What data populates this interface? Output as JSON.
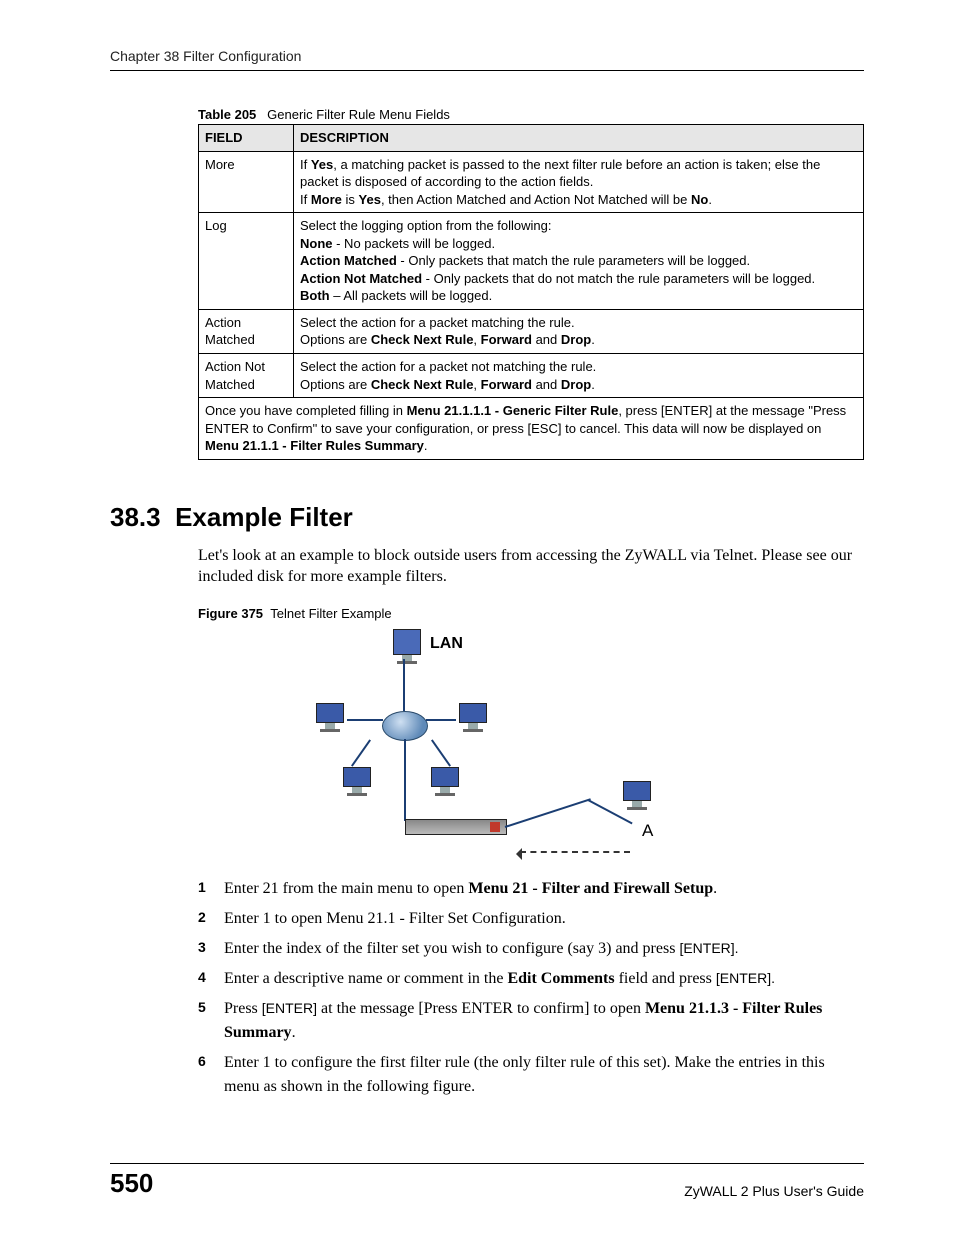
{
  "header": {
    "running_head": "Chapter 38 Filter Configuration"
  },
  "table": {
    "caption_number": "Table 205",
    "caption_title": "Generic Filter Rule Menu Fields",
    "headers": {
      "field": "FIELD",
      "description": "DESCRIPTION"
    },
    "rows": [
      {
        "field": "More",
        "lines": [
          {
            "pre": "If ",
            "b1": "Yes",
            "mid": ", a matching packet is passed to the next filter rule before an action is taken; else the packet is disposed of according to the action fields."
          },
          {
            "pre": "If ",
            "b1": "More",
            "mid": " is ",
            "b2": "Yes",
            "mid2": ", then Action Matched and Action Not Matched will be ",
            "b3": "No",
            "post": "."
          }
        ]
      },
      {
        "field": "Log",
        "lines": [
          {
            "text": "Select the logging option from the following:"
          },
          {
            "b1": "None",
            "post": " - No packets will be logged."
          },
          {
            "b1": "Action Matched",
            "post": " - Only packets that match the rule parameters will be logged."
          },
          {
            "b1": "Action Not Matched",
            "post": " - Only packets that do not match the rule parameters will be logged."
          },
          {
            "b1": "Both",
            "post": " – All packets will be logged."
          }
        ]
      },
      {
        "field": "Action Matched",
        "lines": [
          {
            "text": "Select the action for a packet matching the rule."
          },
          {
            "pre": "Options are ",
            "b1": "Check Next Rule",
            "mid": ", ",
            "b2": "Forward",
            "mid2": " and ",
            "b3": "Drop",
            "post": "."
          }
        ]
      },
      {
        "field": "Action Not Matched",
        "lines": [
          {
            "text": "Select the action for a packet not matching the rule."
          },
          {
            "pre": "Options are ",
            "b1": "Check Next Rule",
            "mid": ", ",
            "b2": "Forward",
            "mid2": " and ",
            "b3": "Drop",
            "post": "."
          }
        ]
      }
    ],
    "footer_note": {
      "pre": "Once you have completed filling in ",
      "b1": "Menu 21.1.1.1 - Generic Filter Rule",
      "mid": ", press [ENTER] at the message \"Press ENTER to Confirm\" to save your configuration, or press [ESC] to cancel. This data will now be displayed on ",
      "b2": "Menu 21.1.1 - Filter Rules Summary",
      "post": "."
    }
  },
  "section": {
    "number": "38.3",
    "title": "Example Filter",
    "intro": "Let's look at an example to block outside users from accessing the ZyWALL via Telnet. Please see our included disk for more example filters."
  },
  "figure": {
    "caption_number": "Figure 375",
    "caption_title": "Telnet Filter Example",
    "lan_label": "LAN",
    "a_label": "A"
  },
  "steps": [
    {
      "pre": "Enter 21 from the main menu to open ",
      "b1": "Menu 21 - Filter and Firewall Setup",
      "post": "."
    },
    {
      "text": "Enter 1 to open Menu 21.1 - Filter Set Configuration."
    },
    {
      "pre": "Enter the index of the filter set you wish to configure (say 3) and press ",
      "sans": "[ENTER].",
      "post": ""
    },
    {
      "pre": "Enter a descriptive name or comment in the ",
      "b1": "Edit Comments",
      "mid": " field and press ",
      "sans": "[ENTER].",
      "post": ""
    },
    {
      "pre": "Press ",
      "sans": "[ENTER]",
      "mid": " at the message  [Press ENTER to confirm] to open ",
      "b1": "Menu 21.1.3 - Filter Rules Summary",
      "post": "."
    },
    {
      "text": "Enter 1 to configure the first filter rule (the only filter rule of this set). Make the entries in this menu as shown in the following figure."
    }
  ],
  "footer": {
    "page_number": "550",
    "guide": "ZyWALL 2 Plus User's Guide"
  }
}
